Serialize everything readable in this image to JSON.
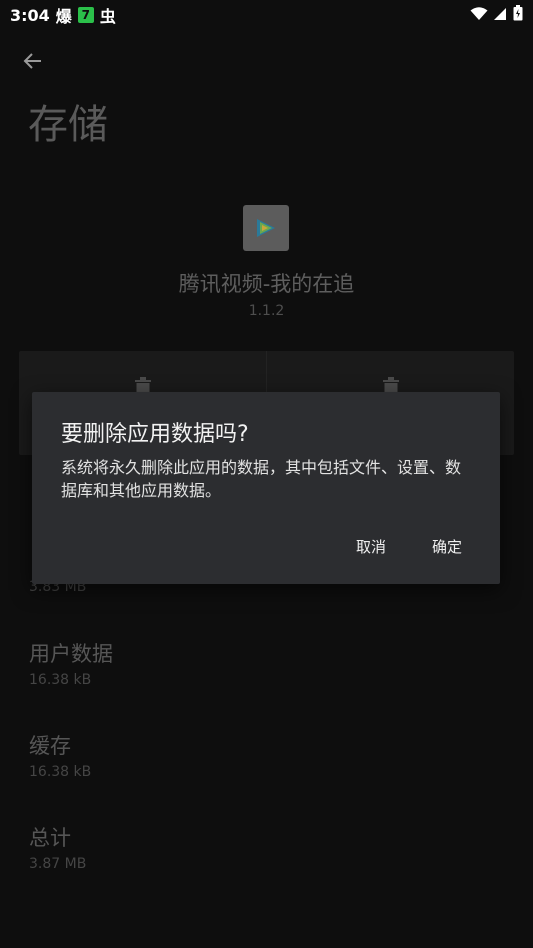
{
  "status_bar": {
    "time": "3:04",
    "notif_1": "爆",
    "notif_badge": "7",
    "notif_2": "虫"
  },
  "page": {
    "title": "存储"
  },
  "app": {
    "name": "腾讯视频-我的在追",
    "version": "1.1.2"
  },
  "storage": {
    "app_size_value": "3.83 MB",
    "user_data_label": "用户数据",
    "user_data_value": "16.38 kB",
    "cache_label": "缓存",
    "cache_value": "16.38 kB",
    "total_label": "总计",
    "total_value": "3.87 MB"
  },
  "dialog": {
    "title": "要删除应用数据吗?",
    "message": "系统将永久删除此应用的数据，其中包括文件、设置、数据库和其他应用数据。",
    "cancel_label": "取消",
    "ok_label": "确定"
  },
  "icons": {
    "back": "arrow-left-icon",
    "trash": "trash-icon",
    "wifi": "wifi-icon",
    "signal": "signal-icon",
    "battery": "battery-icon"
  },
  "colors": {
    "background": "#0e0e0e",
    "dialog_bg": "#2c2d30",
    "badge_green": "#2bc04a"
  }
}
